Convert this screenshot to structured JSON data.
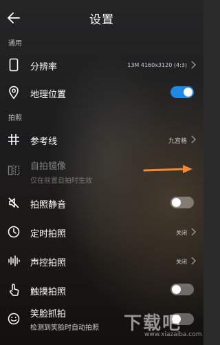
{
  "header": {
    "title": "设置"
  },
  "sections": {
    "general": "通用",
    "photo": "拍照"
  },
  "rows": {
    "resolution": {
      "label": "分辨率",
      "value": "13M 4160x3120 (4:3)"
    },
    "location": {
      "label": "地理位置",
      "toggle": true
    },
    "gridlines": {
      "label": "参考线",
      "value": "九宫格"
    },
    "mirror": {
      "label": "自拍镜像",
      "sub": "仅在前置自拍时生效"
    },
    "mute": {
      "label": "拍照静音",
      "toggle": false
    },
    "timer": {
      "label": "定时拍照",
      "value": "关闭"
    },
    "voice": {
      "label": "声控拍照",
      "value": "关闭"
    },
    "touch": {
      "label": "触摸拍照",
      "toggle": false
    },
    "smile": {
      "label": "笑脸抓拍",
      "sub": "检测到笑脸时自动拍照",
      "toggle": false
    }
  },
  "watermark": {
    "text": "下载吧",
    "sub": "www.xiazaiba.com"
  },
  "colors": {
    "accent": "#1e88e5",
    "arrow": "#f0883a"
  }
}
